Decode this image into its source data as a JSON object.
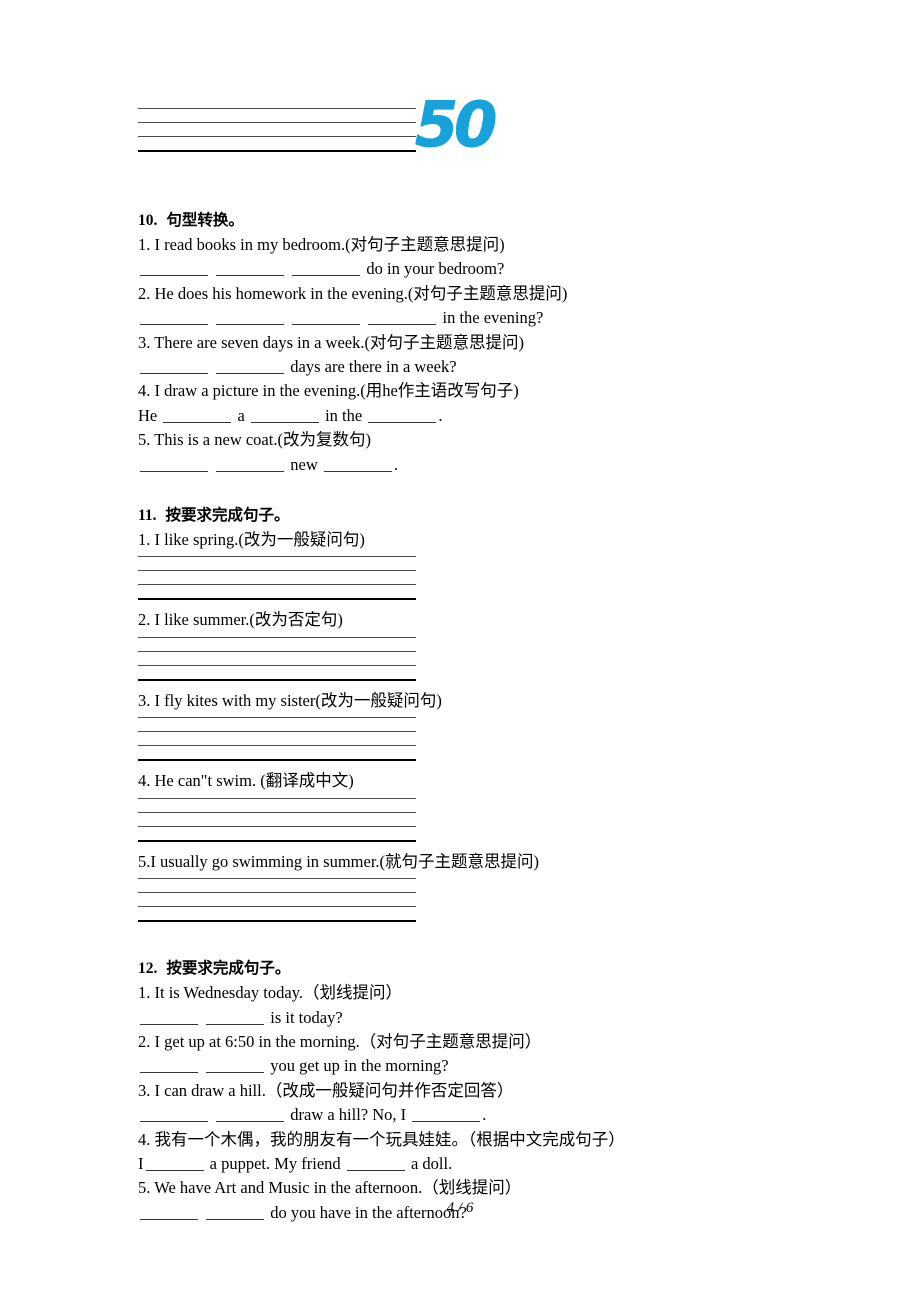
{
  "page": {
    "footer": "4 / 6",
    "logo_text": "50",
    "logo_color": "#17A2DC"
  },
  "sections": [
    {
      "number": "10.",
      "title": "句型转换。",
      "items": [
        {
          "question": "1. I read books in my bedroom.(对句子主题意思提问)",
          "answer_prefix": "",
          "answer_suffix": "do in your bedroom?",
          "blanks": 3
        },
        {
          "question": "2. He does his homework in the evening.(对句子主题意思提问)",
          "answer_prefix": "",
          "answer_suffix": "in the evening?",
          "blanks": 4
        },
        {
          "question": "3. There are seven days in a week.(对句子主题意思提问)",
          "answer_prefix": "",
          "answer_suffix": "days are there in a week?",
          "blanks": 2
        },
        {
          "question": "4. I draw a picture in the evening.(用he作主语改写句子)",
          "answer_template": "He ___ a ___ in the ___.",
          "blanks": 3
        },
        {
          "question": "5. This is a new coat.(改为复数句)",
          "answer_template": "___ ___ new ___.",
          "blanks": 3
        }
      ]
    },
    {
      "number": "11.",
      "title": "按要求完成句子。",
      "items": [
        {
          "question": "1. I like spring.(改为一般疑问句)",
          "answer_lines": 4
        },
        {
          "question": "2. I like summer.(改为否定句)",
          "answer_lines": 4
        },
        {
          "question": "3. I fly kites with my sister(改为一般疑问句)",
          "answer_lines": 4
        },
        {
          "question": "4. He can\"t swim. (翻译成中文)",
          "answer_lines": 4
        },
        {
          "question": "5.I usually go swimming in summer.(就句子主题意思提问)",
          "answer_lines": 4
        }
      ]
    },
    {
      "number": "12.",
      "title": "按要求完成句子。",
      "items": [
        {
          "question": "1. It is Wednesday today.（划线提问）",
          "answer_suffix": "is it today?",
          "blanks": 2
        },
        {
          "question": "2. I get up at 6:50 in the morning.（对句子主题意思提问）",
          "answer_suffix": "you get up in the morning?",
          "blanks": 2
        },
        {
          "question": "3. I can draw a hill.（改成一般疑问句并作否定回答）",
          "answer_template": "___ ___ draw a hill? No, I ___.",
          "blanks": 3
        },
        {
          "question": "4. 我有一个木偶，我的朋友有一个玩具娃娃。（根据中文完成句子）",
          "answer_template": "I ___ a puppet. My friend ___ a doll.",
          "blanks": 2
        },
        {
          "question": "5. We have Art and Music in the afternoon.（划线提问）",
          "answer_suffix": "do you have in the afternoon?",
          "blanks": 2
        }
      ]
    }
  ]
}
